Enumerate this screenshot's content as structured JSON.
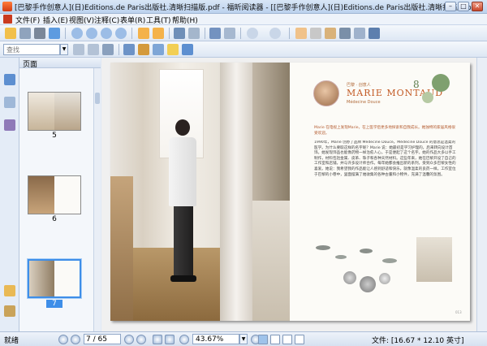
{
  "window": {
    "title": "[巴黎手作创意人](日)Editions.de Paris出版社.清晰扫描版.pdf - 福昕阅读器 - [[巴黎手作创意人](日)Editions.de Paris出版社.清晰扫描版.pdf]",
    "minimize": "–",
    "maximize": "□",
    "close": "✕"
  },
  "menu": [
    "文件(F)",
    "插入(E)",
    "视图(V)",
    "注释(C)",
    "表单(R)",
    "工具(T)",
    "帮助(H)"
  ],
  "search": {
    "placeholder": "查找"
  },
  "panel": {
    "title": "页面",
    "thumbs": [
      {
        "label": "5",
        "selected": false
      },
      {
        "label": "6",
        "selected": false
      },
      {
        "label": "7",
        "selected": true
      }
    ]
  },
  "page": {
    "top_small": "巴黎 · 创意人",
    "name": "MARIE MONTAUD",
    "subtitle": "Médecine Douce",
    "intro": "Marie 在电视上发现Marie，在上医学后更多地探索和自我成长。她独特的家居风格很受欢迎。",
    "body": "1990年，Marie 创办了品牌 Médecine Douce，Médecine Douce 的意思是温柔的医学。为什么要取这样的名字呢？Marie 说：她最初是学习护理的，后来转向设计首饰。她发现饰品也能像药物一样治愈人心，于是便起了这个名字。她的作品大多以手工制作，材料包括金属、皮革、珠子和各种天然材料。这些年来，她在巴黎开设了自己的工作室和店铺，并与许多设计师合作。每年她都会推出新的系列，受到众多巴黎女性的喜爱。她说：我希望我的作品能让人感到舒适和快乐，就像温柔的良药一样。工作室位于巴黎的小巷中，里面摆满了她收集的各种古董和小物件，充满了温馨的氛围。",
    "folio": "013"
  },
  "status": {
    "ready": "就绪",
    "page_current": "7 / 65",
    "zoom": "43.67%",
    "doc_size": "文件: [16.67 * 12.10 英寸]"
  },
  "colors": {
    "accent": "#3e8ee8",
    "name_color": "#c25a24"
  }
}
